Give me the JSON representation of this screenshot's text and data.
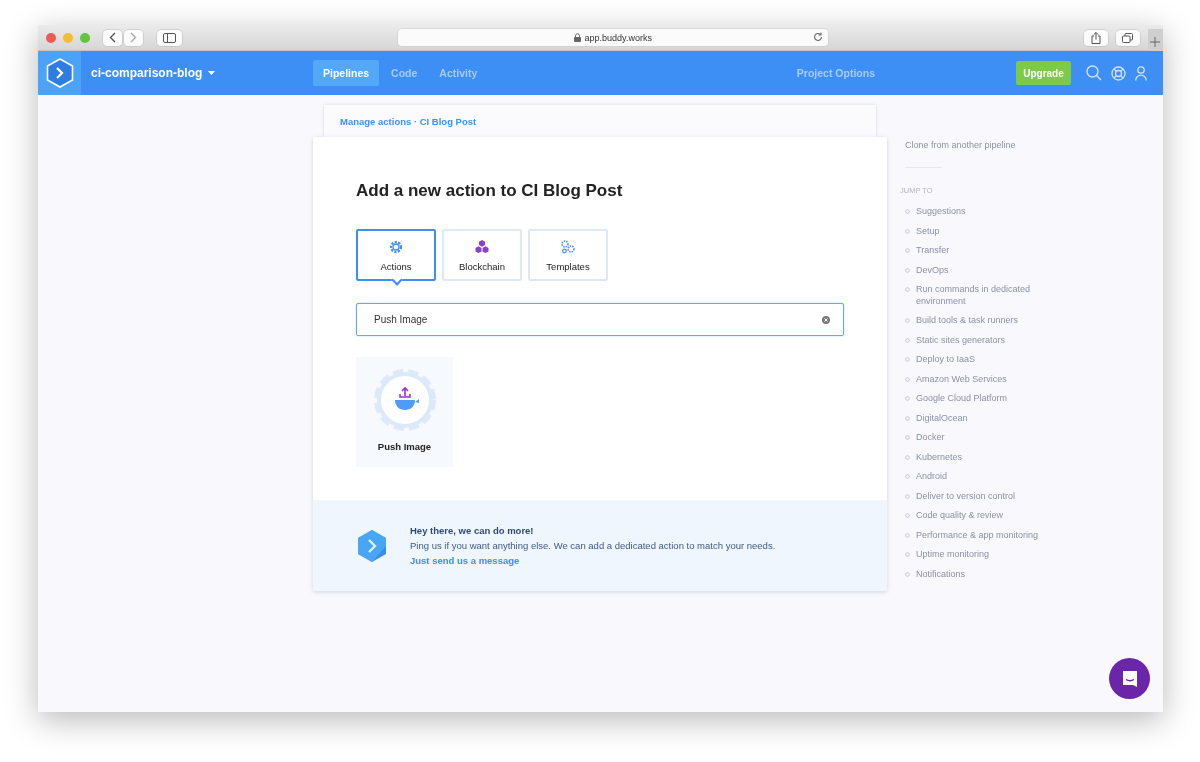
{
  "browser": {
    "url": "app.buddy.works"
  },
  "navbar": {
    "project": "ci-comparison-blog",
    "nav": [
      {
        "label": "Pipelines",
        "selected": true
      },
      {
        "label": "Code",
        "selected": false
      },
      {
        "label": "Activity",
        "selected": false
      }
    ],
    "project_options": "Project Options",
    "upgrade": "Upgrade"
  },
  "breadcrumb": "Manage actions · CI Blog Post",
  "heading": "Add a new action to CI Blog Post",
  "tabs": [
    {
      "label": "Actions",
      "kind": "gear",
      "selected": true
    },
    {
      "label": "Blockchain",
      "kind": "cubes",
      "selected": false
    },
    {
      "label": "Templates",
      "kind": "gears",
      "selected": false
    }
  ],
  "search": {
    "value": "Push Image"
  },
  "results": [
    {
      "label": "Push Image"
    }
  ],
  "promo": {
    "title": "Hey there, we can do more!",
    "text": "Ping us if you want anything else. We can add a dedicated action to match your needs.",
    "link": "Just send us a message"
  },
  "sidebar": {
    "clone": "Clone from another pipeline",
    "jump_heading": "JUMP TO",
    "items": [
      "Suggestions",
      "Setup",
      "Transfer",
      "DevOps",
      "Run commands in dedicated environment",
      "Build tools & task runners",
      "Static sites generators",
      "Deploy to IaaS",
      "Amazon Web Services",
      "Google Cloud Platform",
      "DigitalOcean",
      "Docker",
      "Kubernetes",
      "Android",
      "Deliver to version control",
      "Code quality & review",
      "Performance & app monitoring",
      "Uptime monitoring",
      "Notifications"
    ]
  }
}
